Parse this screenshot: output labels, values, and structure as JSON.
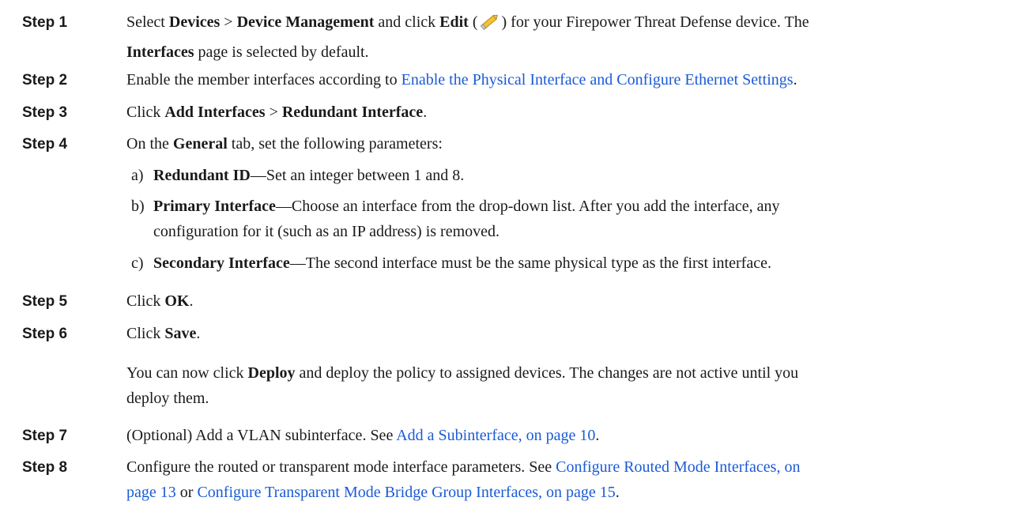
{
  "steps": [
    {
      "label": "Step 1",
      "t1": "Select ",
      "b1": "Devices",
      "t2": " > ",
      "b2": "Device Management",
      "t3": " and click ",
      "b3": "Edit",
      "t4": " (",
      "icon": "pencil-edit-icon",
      "t5": ") for your Firepower Threat Defense device. The",
      "b4": "Interfaces",
      "t6": " page is selected by default."
    },
    {
      "label": "Step 2",
      "t1": "Enable the member interfaces according to ",
      "link1": "Enable the Physical Interface and Configure Ethernet Settings",
      "t2": "."
    },
    {
      "label": "Step 3",
      "t1": "Click ",
      "b1": "Add Interfaces",
      "t2": " > ",
      "b2": "Redundant Interface",
      "t3": "."
    },
    {
      "label": "Step 4",
      "t1": "On the ",
      "b1": "General",
      "t2": " tab, set the following parameters:",
      "subs": [
        {
          "letter": "a)",
          "bold": "Redundant ID",
          "text": "—Set an integer between 1 and 8."
        },
        {
          "letter": "b)",
          "bold": "Primary Interface",
          "text": "—Choose an interface from the drop-down list. After you add the interface, any",
          "text2": "configuration for it (such as an IP address) is removed."
        },
        {
          "letter": "c)",
          "bold": "Secondary Interface",
          "text": "—The second interface must be the same physical type as the first interface."
        }
      ]
    },
    {
      "label": "Step 5",
      "t1": "Click ",
      "b1": "OK",
      "t2": "."
    },
    {
      "label": "Step 6",
      "t1": "Click ",
      "b1": "Save",
      "t2": ".",
      "note_t1": "You can now click ",
      "note_b1": "Deploy",
      "note_t2": " and deploy the policy to assigned devices. The changes are not active until you",
      "note_t3": "deploy them."
    },
    {
      "label": "Step 7",
      "t1": "(Optional) Add a VLAN subinterface. See ",
      "link1": "Add a Subinterface, on page 10",
      "t2": "."
    },
    {
      "label": "Step 8",
      "t1": "Configure the routed or transparent mode interface parameters. See ",
      "link1": "Configure Routed Mode Interfaces, on",
      "link1b": "page 13",
      "t2": " or ",
      "link2": "Configure Transparent Mode Bridge Group Interfaces, on page 15",
      "t3": "."
    }
  ],
  "colors": {
    "link": "#1a5bd6",
    "text": "#1a1a1a"
  }
}
